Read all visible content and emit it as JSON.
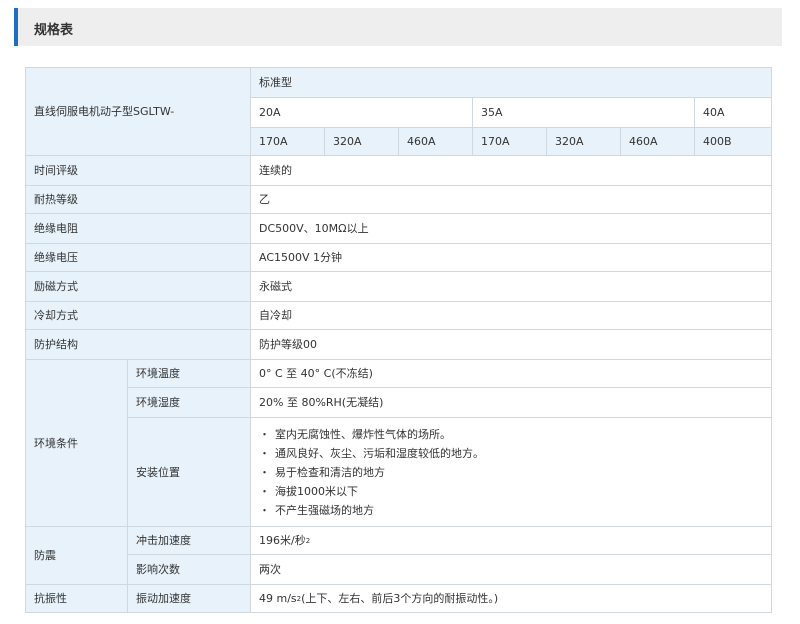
{
  "section": {
    "title": "规格表"
  },
  "table": {
    "model_label": "直线伺服电机动子型SGLTW-",
    "type_label": "标准型",
    "currents": [
      "20A",
      "35A",
      "40A"
    ],
    "models": [
      "170A",
      "320A",
      "460A",
      "170A",
      "320A",
      "460A",
      "400B"
    ],
    "rows": [
      {
        "label": "时间评级",
        "value": "连续的"
      },
      {
        "label": "耐热等级",
        "value": "乙"
      },
      {
        "label": "绝缘电阻",
        "value": "DC500V、10MΩ以上"
      },
      {
        "label": "绝缘电压",
        "value": "AC1500V 1分钟"
      },
      {
        "label": "励磁方式",
        "value": "永磁式"
      },
      {
        "label": "冷却方式",
        "value": "自冷却"
      },
      {
        "label": "防护结构",
        "value": "防护等级00"
      }
    ],
    "environment": {
      "label": "环境条件",
      "temperature_label": "环境温度",
      "temperature_value": "0° C 至 40° C(不冻结)",
      "humidity_label": "环境湿度",
      "humidity_value": "20% 至 80%RH(无凝结)",
      "location_label": "安装位置",
      "location_items": [
        "室内无腐蚀性、爆炸性气体的场所。",
        "通风良好、灰尘、污垢和湿度较低的地方。",
        "易于检查和清洁的地方",
        "海拔1000米以下",
        "不产生强磁场的地方"
      ],
      "bullet": "・"
    },
    "shock": {
      "label": "防震",
      "accel_label": "冲击加速度",
      "accel_value": "196米/秒",
      "accel_sup": "2",
      "count_label": "影响次数",
      "count_value": "两次"
    },
    "vibration": {
      "label": "抗振性",
      "accel_label": "振动加速度",
      "value_pre": "49 m/s",
      "value_sup": "2",
      "value_post": "(上下、左右、前后3个方向的耐振动性。)"
    }
  }
}
